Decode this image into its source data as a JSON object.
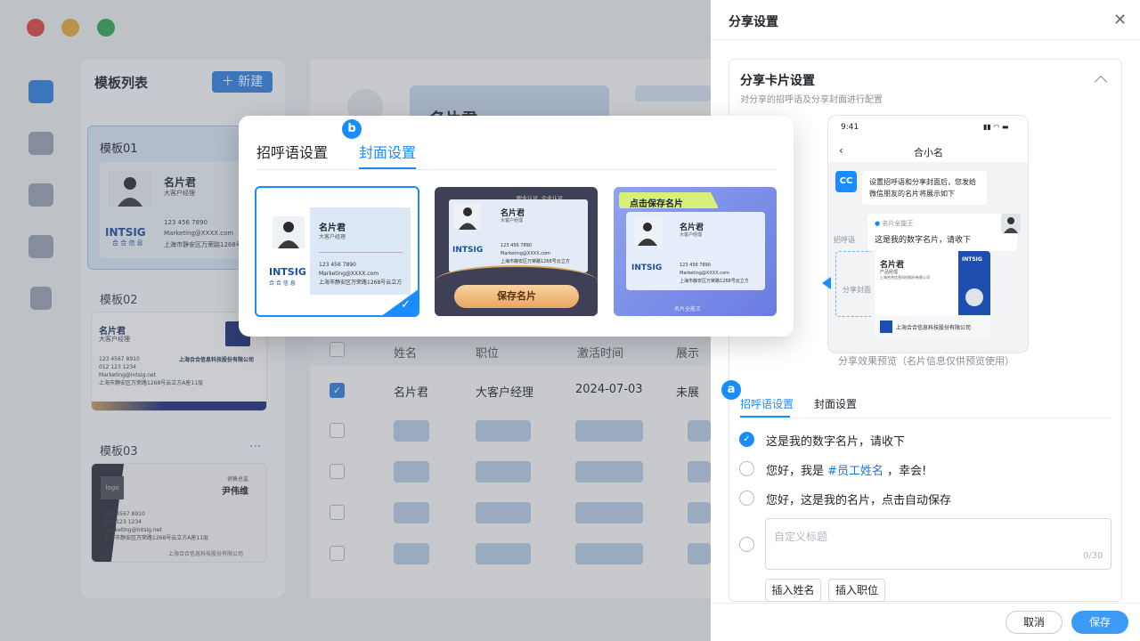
{
  "app": {
    "templates_title": "模板列表",
    "new_button": "新建",
    "templates": [
      {
        "name": "模板01"
      },
      {
        "name": "模板02"
      },
      {
        "name": "模板03",
        "more": "···"
      }
    ],
    "card_sample": {
      "name": "名片君",
      "title": "大客户经理",
      "brand": "INTSIG",
      "brand_cn": "合 合 信 息",
      "phone": "123 456 7890",
      "email": "Marketing@XXXX.com",
      "address": "上海市静安区万荣路1268号"
    },
    "template02_card": {
      "name": "名片君",
      "title": "大客户经理",
      "phone": "123 4567 8910",
      "phone2": "012 123 1234",
      "email": "Marketing@intsig.net",
      "address": "上海市静安区万荣路1268号云立方A座11层",
      "company": "上海合合信息科技股份有限公司"
    },
    "template03_card": {
      "logo": "logo",
      "role": "销售总监",
      "name": "尹伟维",
      "phone": "123 4567 8910",
      "phone2": "012 123 1234",
      "email": "marketing@intsig.net",
      "address": "上海市静安区万荣路1268号云立方A座11层",
      "company": "上海合合信息科技股份有限公司"
    },
    "header_name": "名片君",
    "table": {
      "headers": [
        "姓名",
        "职位",
        "激活时间",
        "展示"
      ],
      "row": [
        "名片君",
        "大客户经理",
        "2024-07-03",
        "未展"
      ]
    }
  },
  "popup": {
    "badge": "b",
    "tabs": [
      "招呼语设置",
      "封面设置"
    ],
    "active_tab": 1,
    "card1": {
      "name": "名片君",
      "title": "大客户经理",
      "phone": "123 456 7890",
      "email": "Marketing@XXXX.com",
      "address": "上海市静安区万荣路1268号云立方",
      "brand": "INTSIG",
      "brand_cn": "合 合 信 息"
    },
    "card2": {
      "tag1": "职业认证",
      "tag2": "企业认证",
      "button": "保存名片"
    },
    "card3": {
      "ribbon": "点击保存名片",
      "footer": "名片全能王"
    }
  },
  "drawer": {
    "title": "分享设置",
    "section_title": "分享卡片设置",
    "section_desc": "对分享的招呼语及分享封面进行配置",
    "phone": {
      "time": "9:41",
      "chat_title": "合小名",
      "bot_icon": "CC",
      "bot_message": "设置招呼语和分享封面后，您发给微信朋友的名片将展示如下",
      "label_greeting": "招呼语",
      "label_cover": "分享封面",
      "sender": "名片全能王",
      "greeting": "这是我的数字名片，请收下",
      "card_name": "名片君",
      "card_sub": "产品经理",
      "card_company_line": "上海合合信息科技股份有限公司",
      "card_brand": "INTSIG",
      "card_footer": "上海合合信息科技股份有限公司"
    },
    "preview_caption": "分享效果预览（名片信息仅供预览使用）",
    "badge": "a",
    "tabs": [
      "招呼语设置",
      "封面设置"
    ],
    "active_tab": 0,
    "options": [
      {
        "text": "这是我的数字名片，请收下",
        "checked": true
      },
      {
        "prefix": "您好，我是 ",
        "var": "#员工姓名",
        "suffix": " ，幸会!",
        "checked": false
      },
      {
        "text": "您好，这是我的名片，点击自动保存",
        "checked": false
      }
    ],
    "custom_placeholder": "自定义标题",
    "custom_counter": "0/30",
    "insert_name": "插入姓名",
    "insert_title": "插入职位",
    "cancel": "取消",
    "save": "保存"
  },
  "colors": {
    "accent": "#1a8cff",
    "save_button": "#3b9bf5",
    "var_text": "#1a73e8"
  }
}
